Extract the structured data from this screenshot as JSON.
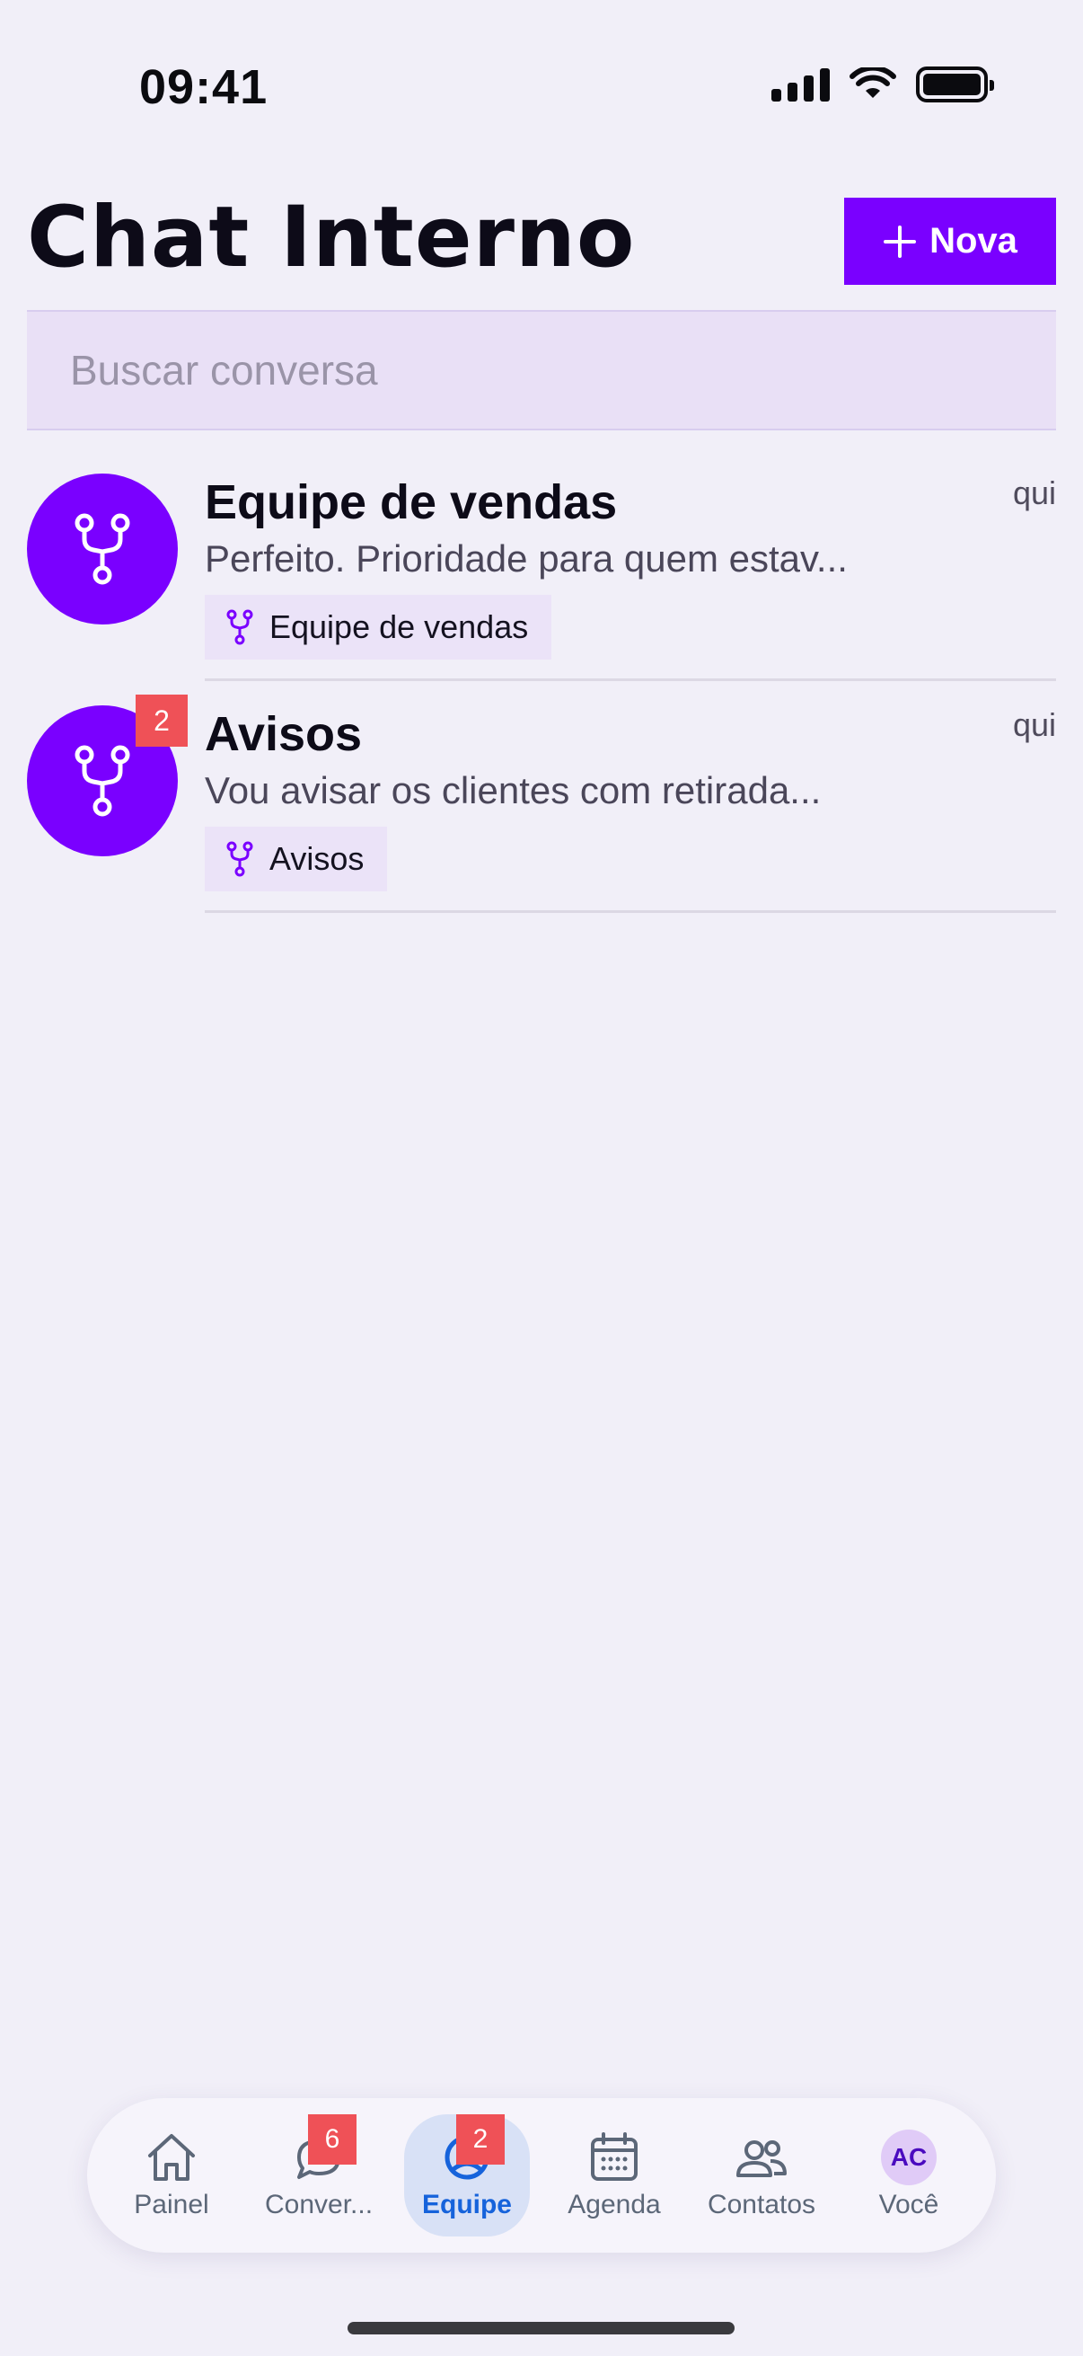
{
  "status_bar": {
    "time": "09:41"
  },
  "header": {
    "title": "Chat Interno",
    "new_button_label": "Nova"
  },
  "search": {
    "placeholder": "Buscar conversa",
    "value": ""
  },
  "conversations": [
    {
      "name": "Equipe de vendas",
      "preview": "Perfeito. Prioridade para quem estav...",
      "time": "qui",
      "tag": "Equipe de vendas",
      "unread": null,
      "icon": "branch-icon"
    },
    {
      "name": "Avisos",
      "preview": "Vou avisar os clientes com retirada...",
      "time": "qui",
      "tag": "Avisos",
      "unread": "2",
      "icon": "branch-icon"
    }
  ],
  "tab_bar": {
    "items": [
      {
        "label": "Painel",
        "icon": "home-icon",
        "badge": null,
        "active": false
      },
      {
        "label": "Conver...",
        "icon": "chat-icon",
        "badge": "6",
        "active": false
      },
      {
        "label": "Equipe",
        "icon": "team-icon",
        "badge": "2",
        "active": true
      },
      {
        "label": "Agenda",
        "icon": "calendar-icon",
        "badge": null,
        "active": false
      },
      {
        "label": "Contatos",
        "icon": "contacts-icon",
        "badge": null,
        "active": false
      },
      {
        "label": "Você",
        "icon": "avatar",
        "avatar_initials": "AC",
        "badge": null,
        "active": false
      }
    ]
  },
  "colors": {
    "accent": "#7a00ff",
    "badge": "#ef5157",
    "active_tab": "#1663db",
    "background": "#f1eff8"
  }
}
